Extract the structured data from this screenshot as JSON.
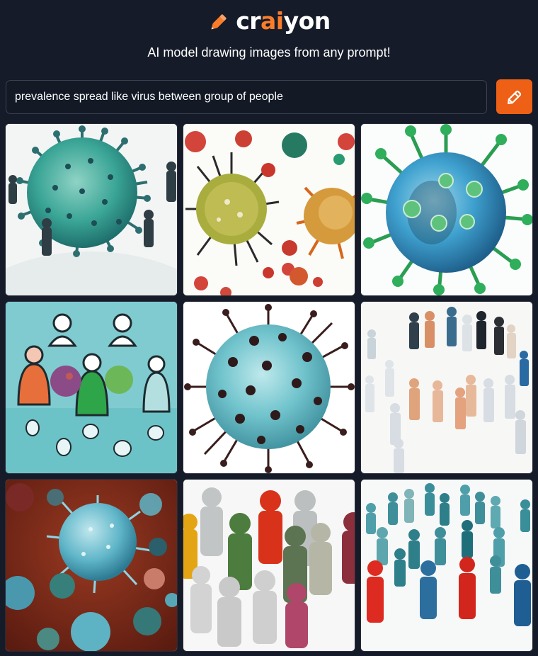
{
  "brand": {
    "logo_prefix": "cr",
    "logo_accent": "ai",
    "logo_suffix": "yon",
    "accent_color": "#f97c2b",
    "icon": "pencil-icon"
  },
  "tagline": "AI model drawing images from any prompt!",
  "prompt": {
    "value": "prevalence spread like virus between group of people",
    "placeholder": ""
  },
  "draw_button": {
    "icon": "pencil-icon",
    "color": "#ed6016"
  },
  "images": [
    {
      "kind": "virus-teal-with-people"
    },
    {
      "kind": "many-colorful-viruses"
    },
    {
      "kind": "blue-virus-green-spikes"
    },
    {
      "kind": "people-cluster-teal"
    },
    {
      "kind": "teal-virus-dark-spikes"
    },
    {
      "kind": "people-circle-white"
    },
    {
      "kind": "viruses-red-background"
    },
    {
      "kind": "colorful-figures-crowd"
    },
    {
      "kind": "teal-and-red-figures"
    }
  ]
}
